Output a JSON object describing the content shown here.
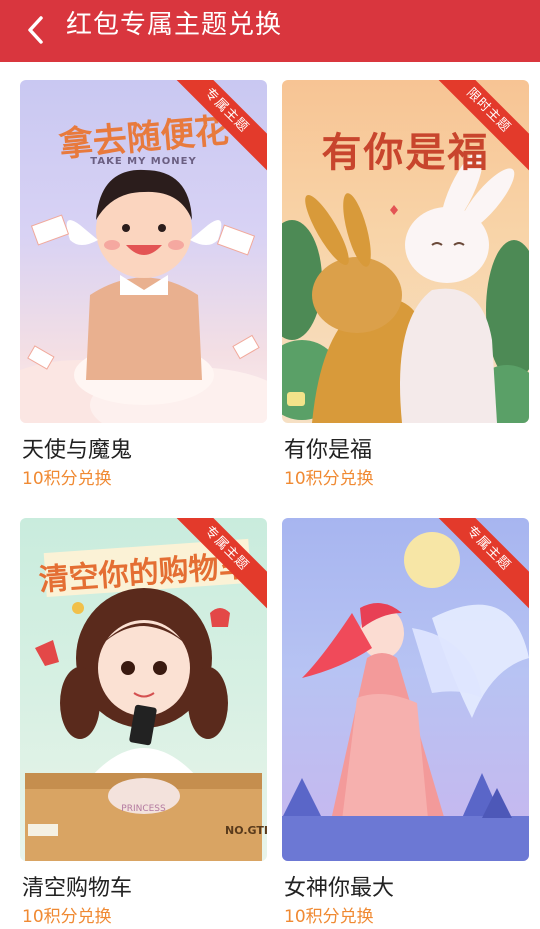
{
  "header": {
    "title": "红包专属主题兑换",
    "bg_color": "#d9363e"
  },
  "cards": [
    {
      "name": "天使与魔鬼",
      "price": "10积分兑换",
      "ribbon": "专属主题",
      "art_text": "拿去随便花",
      "art_subtext": "TAKE MY MONEY"
    },
    {
      "name": "有你是福",
      "price": "10积分兑换",
      "ribbon": "限时主题",
      "art_text": "有你是福"
    },
    {
      "name": "清空购物车",
      "price": "10积分兑换",
      "ribbon": "专属主题",
      "art_text": "清空你的购物车",
      "box_text": "PRINCESS",
      "box_label": "NO.GTI"
    },
    {
      "name": "女神你最大",
      "price": "10积分兑换",
      "ribbon": "专属主题"
    }
  ],
  "colors": {
    "accent": "#d9363e",
    "price": "#f08a33",
    "ribbon": "#e33a2b"
  }
}
